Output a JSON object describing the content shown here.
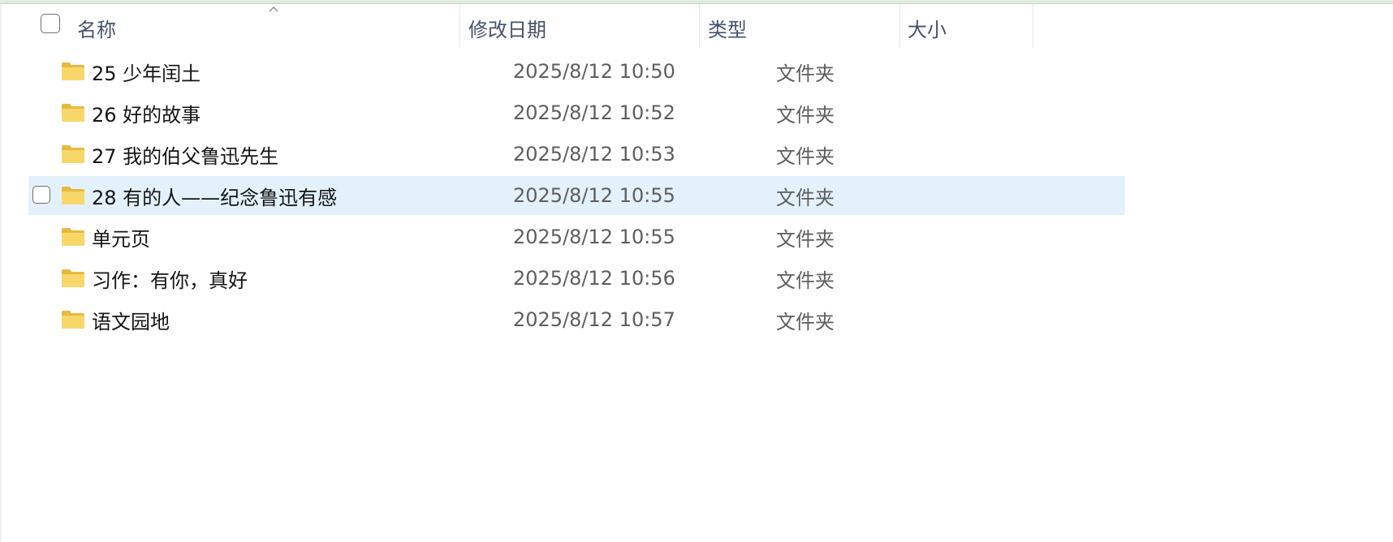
{
  "columns": {
    "name": "名称",
    "modified": "修改日期",
    "type": "类型",
    "size": "大小"
  },
  "sort": {
    "column": "name",
    "direction": "ascending",
    "icon": "chevron-up-icon"
  },
  "rows": [
    {
      "name": "25 少年闰土",
      "modified": "2025/8/12 10:50",
      "type": "文件夹",
      "size": "",
      "icon": "folder-icon",
      "selected": false
    },
    {
      "name": "26 好的故事",
      "modified": "2025/8/12 10:52",
      "type": "文件夹",
      "size": "",
      "icon": "folder-icon",
      "selected": false
    },
    {
      "name": "27 我的伯父鲁迅先生",
      "modified": "2025/8/12 10:53",
      "type": "文件夹",
      "size": "",
      "icon": "folder-icon",
      "selected": false
    },
    {
      "name": "28 有的人——纪念鲁迅有感",
      "modified": "2025/8/12 10:55",
      "type": "文件夹",
      "size": "",
      "icon": "folder-icon",
      "selected": true
    },
    {
      "name": "单元页",
      "modified": "2025/8/12 10:55",
      "type": "文件夹",
      "size": "",
      "icon": "folder-icon",
      "selected": false
    },
    {
      "name": "习作：有你，真好",
      "modified": "2025/8/12 10:56",
      "type": "文件夹",
      "size": "",
      "icon": "folder-icon",
      "selected": false
    },
    {
      "name": "语文园地",
      "modified": "2025/8/12 10:57",
      "type": "文件夹",
      "size": "",
      "icon": "folder-icon",
      "selected": false
    }
  ],
  "colors": {
    "header_text": "#44536b",
    "row_hover_bg": "#e3f1fd",
    "folder_yellow": "#f8d76a",
    "folder_tab": "#e9b83f"
  }
}
